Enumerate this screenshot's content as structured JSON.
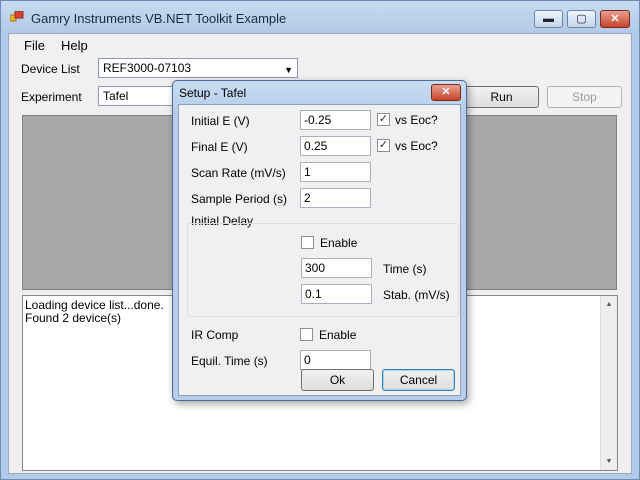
{
  "window": {
    "title": "Gamry Instruments VB.NET Toolkit Example",
    "minimize": "▬",
    "maximize": "▢",
    "close": "✕"
  },
  "menu": {
    "file": "File",
    "help": "Help"
  },
  "form": {
    "device_list_label": "Device List",
    "device_list_value": "REF3000-07103",
    "experiment_label": "Experiment",
    "experiment_value": "Tafel",
    "run_label": "Run",
    "stop_label": "Stop"
  },
  "log": {
    "lines": [
      "Loading device list...done.",
      "Found 2 device(s)"
    ]
  },
  "dialog": {
    "title": "Setup - Tafel",
    "close": "✕",
    "initial_e": {
      "label": "Initial E (V)",
      "value": "-0.25",
      "vs_label": "vs Eoc?",
      "vs_checked": true
    },
    "final_e": {
      "label": "Final E (V)",
      "value": "0.25",
      "vs_label": "vs Eoc?",
      "vs_checked": true
    },
    "scan_rate": {
      "label": "Scan Rate (mV/s)",
      "value": "1"
    },
    "sample_period": {
      "label": "Sample Period (s)",
      "value": "2"
    },
    "initial_delay": {
      "group_label": "Initial Delay",
      "enable_label": "Enable",
      "enable_checked": false,
      "time_value": "300",
      "time_label": "Time (s)",
      "stab_value": "0.1",
      "stab_label": "Stab. (mV/s)"
    },
    "ir_comp": {
      "label": "IR Comp",
      "enable_label": "Enable",
      "checked": false
    },
    "equil_time": {
      "label": "Equil. Time (s)",
      "value": "0"
    },
    "ok_label": "Ok",
    "cancel_label": "Cancel"
  }
}
